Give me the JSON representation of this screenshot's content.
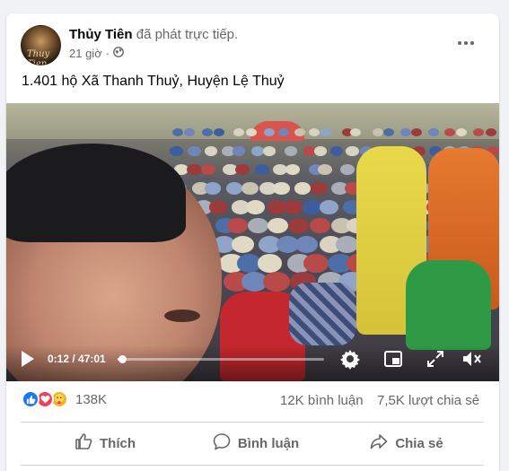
{
  "post": {
    "author": "Thủy Tiên",
    "action": "đã phát trực tiếp.",
    "time": "21 giờ",
    "privacy_icon": "globe-icon",
    "caption": "1.401 hộ Xã Thanh Thuỷ, Huyện Lệ Thuỷ"
  },
  "avatar": {
    "signature": "Thuy Tien"
  },
  "video": {
    "time_display": "0:12 / 47:01",
    "progress_fraction": 0.004,
    "icons": [
      "play-icon",
      "settings-gear-icon",
      "picture-in-picture-icon",
      "fullscreen-expand-icon",
      "volume-muted-icon"
    ]
  },
  "stats": {
    "reaction_icons": [
      "like-reaction-icon",
      "love-reaction-icon",
      "care-reaction-icon"
    ],
    "reactions": "138K",
    "comments": "12K bình luận",
    "shares": "7,5K lượt chia sẻ"
  },
  "actions": {
    "like": "Thích",
    "comment": "Bình luận",
    "share": "Chia sẻ"
  },
  "colors": {
    "like_blue": "#1877f2",
    "love_red": "#f33e58",
    "care_yellow": "#f7b125",
    "secondary_text": "#65676b"
  }
}
